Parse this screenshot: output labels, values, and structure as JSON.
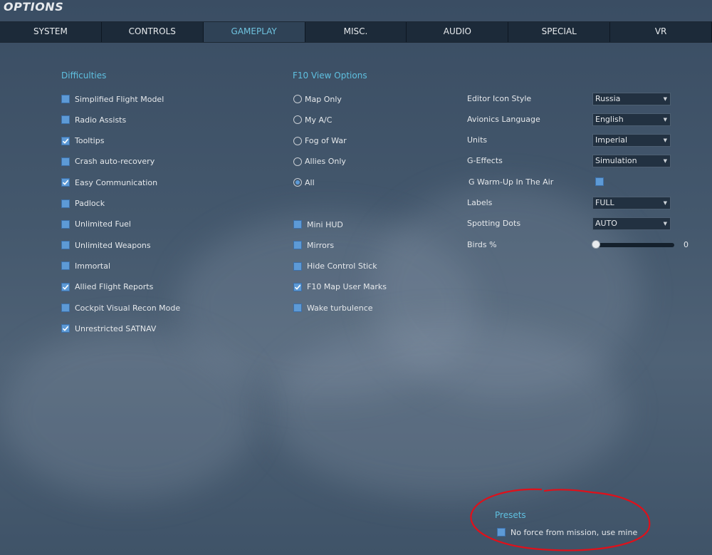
{
  "window": {
    "title": "OPTIONS"
  },
  "tabs": [
    "SYSTEM",
    "CONTROLS",
    "GAMEPLAY",
    "MISC.",
    "AUDIO",
    "SPECIAL",
    "VR"
  ],
  "active_tab": "GAMEPLAY",
  "difficulties": {
    "title": "Difficulties",
    "items": [
      {
        "label": "Simplified Flight Model",
        "checked": false
      },
      {
        "label": "Radio Assists",
        "checked": false
      },
      {
        "label": "Tooltips",
        "checked": true
      },
      {
        "label": "Crash auto-recovery",
        "checked": false
      },
      {
        "label": "Easy Communication",
        "checked": true
      },
      {
        "label": "Padlock",
        "checked": false
      },
      {
        "label": "Unlimited Fuel",
        "checked": false
      },
      {
        "label": "Unlimited Weapons",
        "checked": false
      },
      {
        "label": "Immortal",
        "checked": false
      },
      {
        "label": "Allied Flight Reports",
        "checked": true
      },
      {
        "label": "Cockpit Visual Recon Mode",
        "checked": false
      },
      {
        "label": "Unrestricted SATNAV",
        "checked": true
      }
    ]
  },
  "f10": {
    "title": "F10 View Options",
    "radios": [
      {
        "label": "Map Only",
        "selected": false
      },
      {
        "label": "My A/C",
        "selected": false
      },
      {
        "label": "Fog of War",
        "selected": false
      },
      {
        "label": "Allies Only",
        "selected": false
      },
      {
        "label": "All",
        "selected": true
      }
    ],
    "checks": [
      {
        "label": "Mini HUD",
        "checked": false
      },
      {
        "label": "Mirrors",
        "checked": false
      },
      {
        "label": "Hide Control Stick",
        "checked": false
      },
      {
        "label": "F10 Map User Marks",
        "checked": true
      },
      {
        "label": "Wake turbulence",
        "checked": false
      }
    ]
  },
  "settings": {
    "editor_icon_style": {
      "label": "Editor Icon Style",
      "value": "Russia"
    },
    "avionics_language": {
      "label": "Avionics Language",
      "value": "English"
    },
    "units": {
      "label": "Units",
      "value": "Imperial"
    },
    "g_effects": {
      "label": "G-Effects",
      "value": "Simulation"
    },
    "g_warmup": {
      "label": "G Warm-Up In The Air",
      "checked": false
    },
    "labels": {
      "label": "Labels",
      "value": "FULL"
    },
    "spotting_dots": {
      "label": "Spotting Dots",
      "value": "AUTO"
    },
    "birds": {
      "label": "Birds %",
      "value": "0"
    }
  },
  "presets": {
    "title": "Presets",
    "option": {
      "label": "No force from mission, use mine",
      "checked": false
    }
  },
  "colors": {
    "accent": "#5fc0e0",
    "checkbox": "#5d9ad6",
    "annotation": "#e0101a"
  }
}
